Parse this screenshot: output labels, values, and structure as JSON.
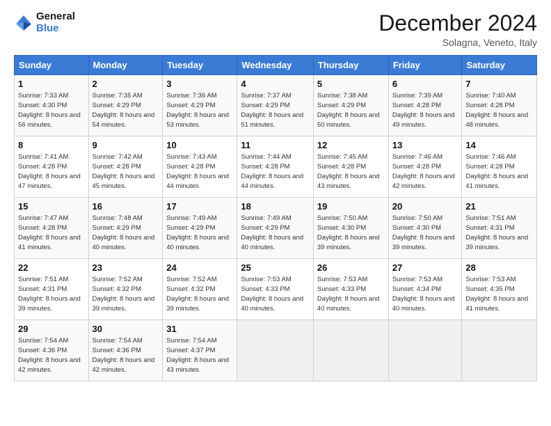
{
  "logo": {
    "text_general": "General",
    "text_blue": "Blue"
  },
  "header": {
    "title": "December 2024",
    "subtitle": "Solagna, Veneto, Italy"
  },
  "days_of_week": [
    "Sunday",
    "Monday",
    "Tuesday",
    "Wednesday",
    "Thursday",
    "Friday",
    "Saturday"
  ],
  "weeks": [
    [
      {
        "day": "1",
        "sunrise": "Sunrise: 7:33 AM",
        "sunset": "Sunset: 4:30 PM",
        "daylight": "Daylight: 8 hours and 56 minutes."
      },
      {
        "day": "2",
        "sunrise": "Sunrise: 7:35 AM",
        "sunset": "Sunset: 4:29 PM",
        "daylight": "Daylight: 8 hours and 54 minutes."
      },
      {
        "day": "3",
        "sunrise": "Sunrise: 7:36 AM",
        "sunset": "Sunset: 4:29 PM",
        "daylight": "Daylight: 8 hours and 53 minutes."
      },
      {
        "day": "4",
        "sunrise": "Sunrise: 7:37 AM",
        "sunset": "Sunset: 4:29 PM",
        "daylight": "Daylight: 8 hours and 51 minutes."
      },
      {
        "day": "5",
        "sunrise": "Sunrise: 7:38 AM",
        "sunset": "Sunset: 4:29 PM",
        "daylight": "Daylight: 8 hours and 50 minutes."
      },
      {
        "day": "6",
        "sunrise": "Sunrise: 7:39 AM",
        "sunset": "Sunset: 4:28 PM",
        "daylight": "Daylight: 8 hours and 49 minutes."
      },
      {
        "day": "7",
        "sunrise": "Sunrise: 7:40 AM",
        "sunset": "Sunset: 4:28 PM",
        "daylight": "Daylight: 8 hours and 48 minutes."
      }
    ],
    [
      {
        "day": "8",
        "sunrise": "Sunrise: 7:41 AM",
        "sunset": "Sunset: 4:28 PM",
        "daylight": "Daylight: 8 hours and 47 minutes."
      },
      {
        "day": "9",
        "sunrise": "Sunrise: 7:42 AM",
        "sunset": "Sunset: 4:28 PM",
        "daylight": "Daylight: 8 hours and 45 minutes."
      },
      {
        "day": "10",
        "sunrise": "Sunrise: 7:43 AM",
        "sunset": "Sunset: 4:28 PM",
        "daylight": "Daylight: 8 hours and 44 minutes."
      },
      {
        "day": "11",
        "sunrise": "Sunrise: 7:44 AM",
        "sunset": "Sunset: 4:28 PM",
        "daylight": "Daylight: 8 hours and 44 minutes."
      },
      {
        "day": "12",
        "sunrise": "Sunrise: 7:45 AM",
        "sunset": "Sunset: 4:28 PM",
        "daylight": "Daylight: 8 hours and 43 minutes."
      },
      {
        "day": "13",
        "sunrise": "Sunrise: 7:46 AM",
        "sunset": "Sunset: 4:28 PM",
        "daylight": "Daylight: 8 hours and 42 minutes."
      },
      {
        "day": "14",
        "sunrise": "Sunrise: 7:46 AM",
        "sunset": "Sunset: 4:28 PM",
        "daylight": "Daylight: 8 hours and 41 minutes."
      }
    ],
    [
      {
        "day": "15",
        "sunrise": "Sunrise: 7:47 AM",
        "sunset": "Sunset: 4:28 PM",
        "daylight": "Daylight: 8 hours and 41 minutes."
      },
      {
        "day": "16",
        "sunrise": "Sunrise: 7:48 AM",
        "sunset": "Sunset: 4:29 PM",
        "daylight": "Daylight: 8 hours and 40 minutes."
      },
      {
        "day": "17",
        "sunrise": "Sunrise: 7:49 AM",
        "sunset": "Sunset: 4:29 PM",
        "daylight": "Daylight: 8 hours and 40 minutes."
      },
      {
        "day": "18",
        "sunrise": "Sunrise: 7:49 AM",
        "sunset": "Sunset: 4:29 PM",
        "daylight": "Daylight: 8 hours and 40 minutes."
      },
      {
        "day": "19",
        "sunrise": "Sunrise: 7:50 AM",
        "sunset": "Sunset: 4:30 PM",
        "daylight": "Daylight: 8 hours and 39 minutes."
      },
      {
        "day": "20",
        "sunrise": "Sunrise: 7:50 AM",
        "sunset": "Sunset: 4:30 PM",
        "daylight": "Daylight: 8 hours and 39 minutes."
      },
      {
        "day": "21",
        "sunrise": "Sunrise: 7:51 AM",
        "sunset": "Sunset: 4:31 PM",
        "daylight": "Daylight: 8 hours and 39 minutes."
      }
    ],
    [
      {
        "day": "22",
        "sunrise": "Sunrise: 7:51 AM",
        "sunset": "Sunset: 4:31 PM",
        "daylight": "Daylight: 8 hours and 39 minutes."
      },
      {
        "day": "23",
        "sunrise": "Sunrise: 7:52 AM",
        "sunset": "Sunset: 4:32 PM",
        "daylight": "Daylight: 8 hours and 39 minutes."
      },
      {
        "day": "24",
        "sunrise": "Sunrise: 7:52 AM",
        "sunset": "Sunset: 4:32 PM",
        "daylight": "Daylight: 8 hours and 39 minutes."
      },
      {
        "day": "25",
        "sunrise": "Sunrise: 7:53 AM",
        "sunset": "Sunset: 4:33 PM",
        "daylight": "Daylight: 8 hours and 40 minutes."
      },
      {
        "day": "26",
        "sunrise": "Sunrise: 7:53 AM",
        "sunset": "Sunset: 4:33 PM",
        "daylight": "Daylight: 8 hours and 40 minutes."
      },
      {
        "day": "27",
        "sunrise": "Sunrise: 7:53 AM",
        "sunset": "Sunset: 4:34 PM",
        "daylight": "Daylight: 8 hours and 40 minutes."
      },
      {
        "day": "28",
        "sunrise": "Sunrise: 7:53 AM",
        "sunset": "Sunset: 4:35 PM",
        "daylight": "Daylight: 8 hours and 41 minutes."
      }
    ],
    [
      {
        "day": "29",
        "sunrise": "Sunrise: 7:54 AM",
        "sunset": "Sunset: 4:36 PM",
        "daylight": "Daylight: 8 hours and 42 minutes."
      },
      {
        "day": "30",
        "sunrise": "Sunrise: 7:54 AM",
        "sunset": "Sunset: 4:36 PM",
        "daylight": "Daylight: 8 hours and 42 minutes."
      },
      {
        "day": "31",
        "sunrise": "Sunrise: 7:54 AM",
        "sunset": "Sunset: 4:37 PM",
        "daylight": "Daylight: 8 hours and 43 minutes."
      },
      null,
      null,
      null,
      null
    ]
  ]
}
